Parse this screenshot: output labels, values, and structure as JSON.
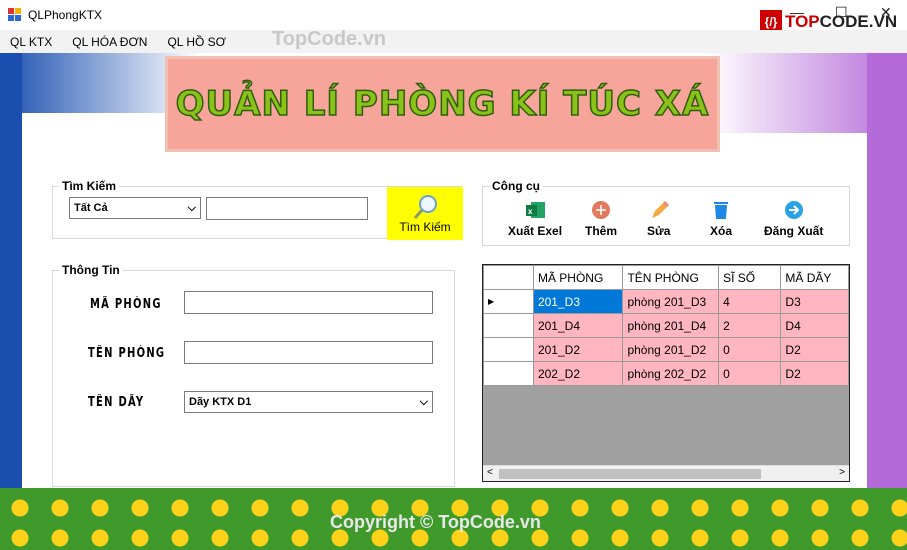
{
  "window": {
    "title": "QLPhongKTX",
    "minimize": "—",
    "maximize": "☐",
    "close": "✕"
  },
  "menu": [
    {
      "label": "QL KTX"
    },
    {
      "label": "QL HÓA ĐƠN"
    },
    {
      "label": "QL HỒ SƠ"
    }
  ],
  "watermarks": {
    "top": "TopCode.vn",
    "bottom": "Copyright © TopCode.vn",
    "logo": "TOPCODE.VN"
  },
  "banner": {
    "title": "QUẢN LÍ PHÒNG KÍ TÚC XÁ"
  },
  "search": {
    "legend": "Tìm Kiếm",
    "filter_value": "Tất Cả",
    "query": "",
    "button": "Tìm Kiếm"
  },
  "info": {
    "legend": "Thông Tin",
    "ma_phong_label": "MÃ PHÒNG",
    "ma_phong": "",
    "ten_phong_label": "TÊN PHÒNG",
    "ten_phong": "",
    "ten_day_label": "TÊN DÃY",
    "ten_day": "Dãy KTX D1"
  },
  "tools": {
    "legend": "Công cụ",
    "items": [
      {
        "label": "Xuất Exel",
        "icon": "excel-icon"
      },
      {
        "label": "Thêm",
        "icon": "plus-circle-icon"
      },
      {
        "label": "Sửa",
        "icon": "pencil-icon"
      },
      {
        "label": "Xóa",
        "icon": "trash-icon"
      },
      {
        "label": "Đăng Xuất",
        "icon": "logout-arrow-icon"
      }
    ]
  },
  "grid": {
    "columns": [
      "MÃ PHÒNG",
      "TÊN PHÒNG",
      "SĨ SỐ",
      "MÃ DÃY"
    ],
    "rows": [
      [
        "201_D3",
        "phòng 201_D3",
        "4",
        "D3"
      ],
      [
        "201_D4",
        "phòng 201_D4",
        "2",
        "D4"
      ],
      [
        "201_D2",
        "phòng 201_D2",
        "0",
        "D2"
      ],
      [
        "202_D2",
        "phòng 202_D2",
        "0",
        "D2"
      ]
    ]
  },
  "colors": {
    "row_bg": "#ffb6c1",
    "selected": "#0078d7",
    "search_button": "#ffff00"
  }
}
